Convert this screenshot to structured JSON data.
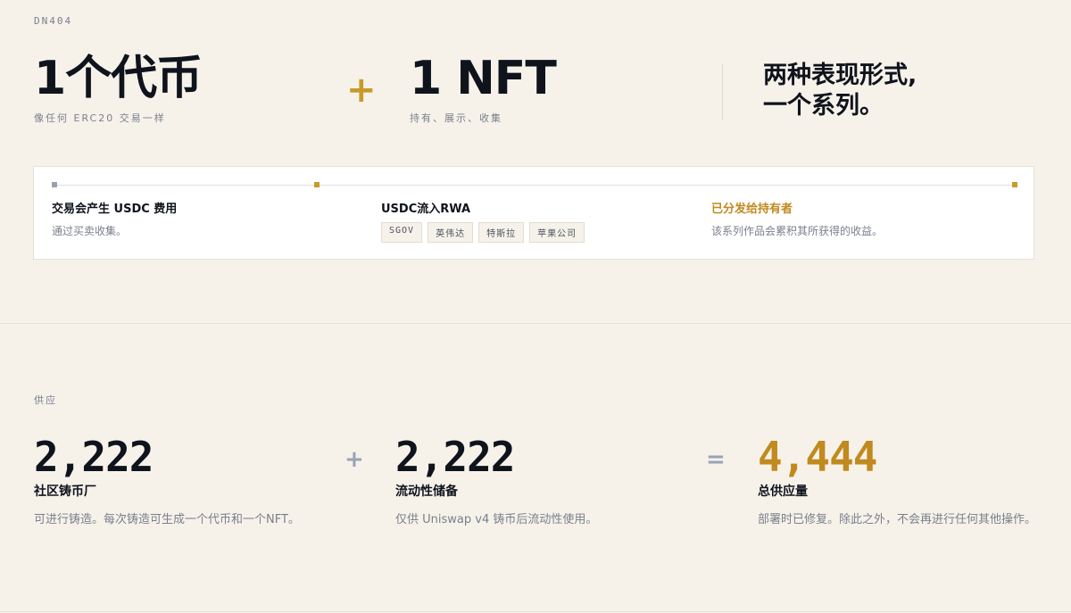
{
  "eyebrow": "DN404",
  "hero": {
    "token": {
      "title": "1个代币",
      "subtitle": "像任何 ERC20 交易一样"
    },
    "plus": "+",
    "nft": {
      "title": "1 NFT",
      "subtitle": "持有、展示、收集"
    },
    "tagline": [
      "两种表现形式,",
      "一个系列。"
    ]
  },
  "flow": {
    "steps": [
      {
        "title": "交易会产生 USDC 费用",
        "desc": "通过买卖收集。"
      },
      {
        "title": "USDC流入RWA",
        "chips": [
          "SGOV",
          "英伟达",
          "特斯拉",
          "苹果公司"
        ]
      },
      {
        "title": "已分发给持有者",
        "desc": "该系列作品会累积其所获得的收益。"
      }
    ]
  },
  "supply": {
    "label": "供应",
    "plus": "+",
    "equals": "=",
    "columns": [
      {
        "number": "2,222",
        "title": "社区铸币厂",
        "desc": "可进行铸造。每次铸造可生成一个代币和一个NFT。"
      },
      {
        "number": "2,222",
        "title": "流动性储备",
        "desc": "仅供 Uniswap v4 铸币后流动性使用。"
      },
      {
        "number": "4,444",
        "title": "总供应量",
        "desc": "部署时已修复。除此之外，不会再进行任何其他操作。"
      }
    ]
  },
  "colors": {
    "accent": "#c89a2a",
    "background": "#f6f2ea",
    "text": "#0f131c"
  }
}
